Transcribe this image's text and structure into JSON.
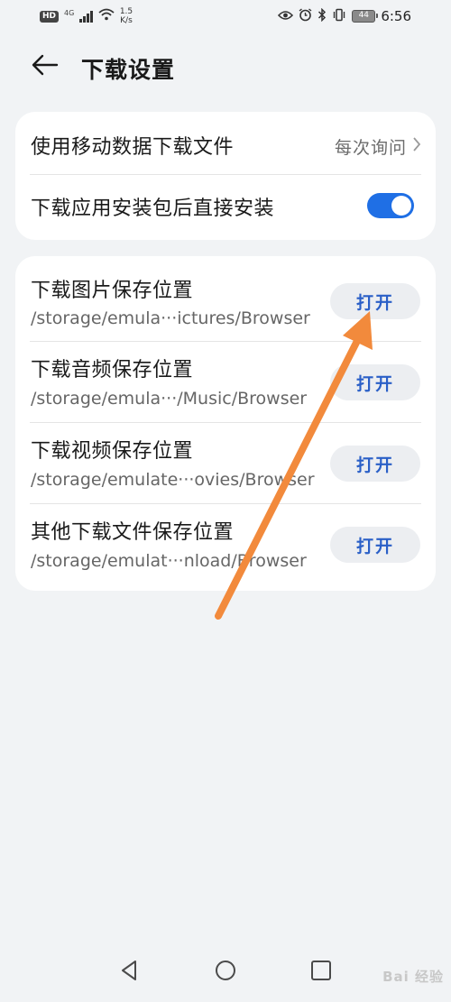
{
  "status_bar": {
    "hd": "HD",
    "network": "4G",
    "speed_value": "1.5",
    "speed_unit": "K/s",
    "battery": "44",
    "time": "6:56"
  },
  "header": {
    "title": "下载设置"
  },
  "general": {
    "mobile_data": {
      "label": "使用移动数据下载文件",
      "value": "每次询问"
    },
    "auto_install": {
      "label": "下载应用安装包后直接安装",
      "enabled": true
    }
  },
  "locations": [
    {
      "label": "下载图片保存位置",
      "path": "/storage/emula···ictures/Browser",
      "button": "打开"
    },
    {
      "label": "下载音频保存位置",
      "path": "/storage/emula···/Music/Browser",
      "button": "打开"
    },
    {
      "label": "下载视频保存位置",
      "path": "/storage/emulate···ovies/Browser",
      "button": "打开"
    },
    {
      "label": "其他下载文件保存位置",
      "path": "/storage/emulat···nload/Browser",
      "button": "打开"
    }
  ],
  "annotation": {
    "arrow_color": "#f28a3c"
  },
  "colors": {
    "background": "#f1f3f5",
    "accent": "#1f6fe5",
    "link": "#2a5fc7"
  },
  "watermark": "Bai 经验"
}
